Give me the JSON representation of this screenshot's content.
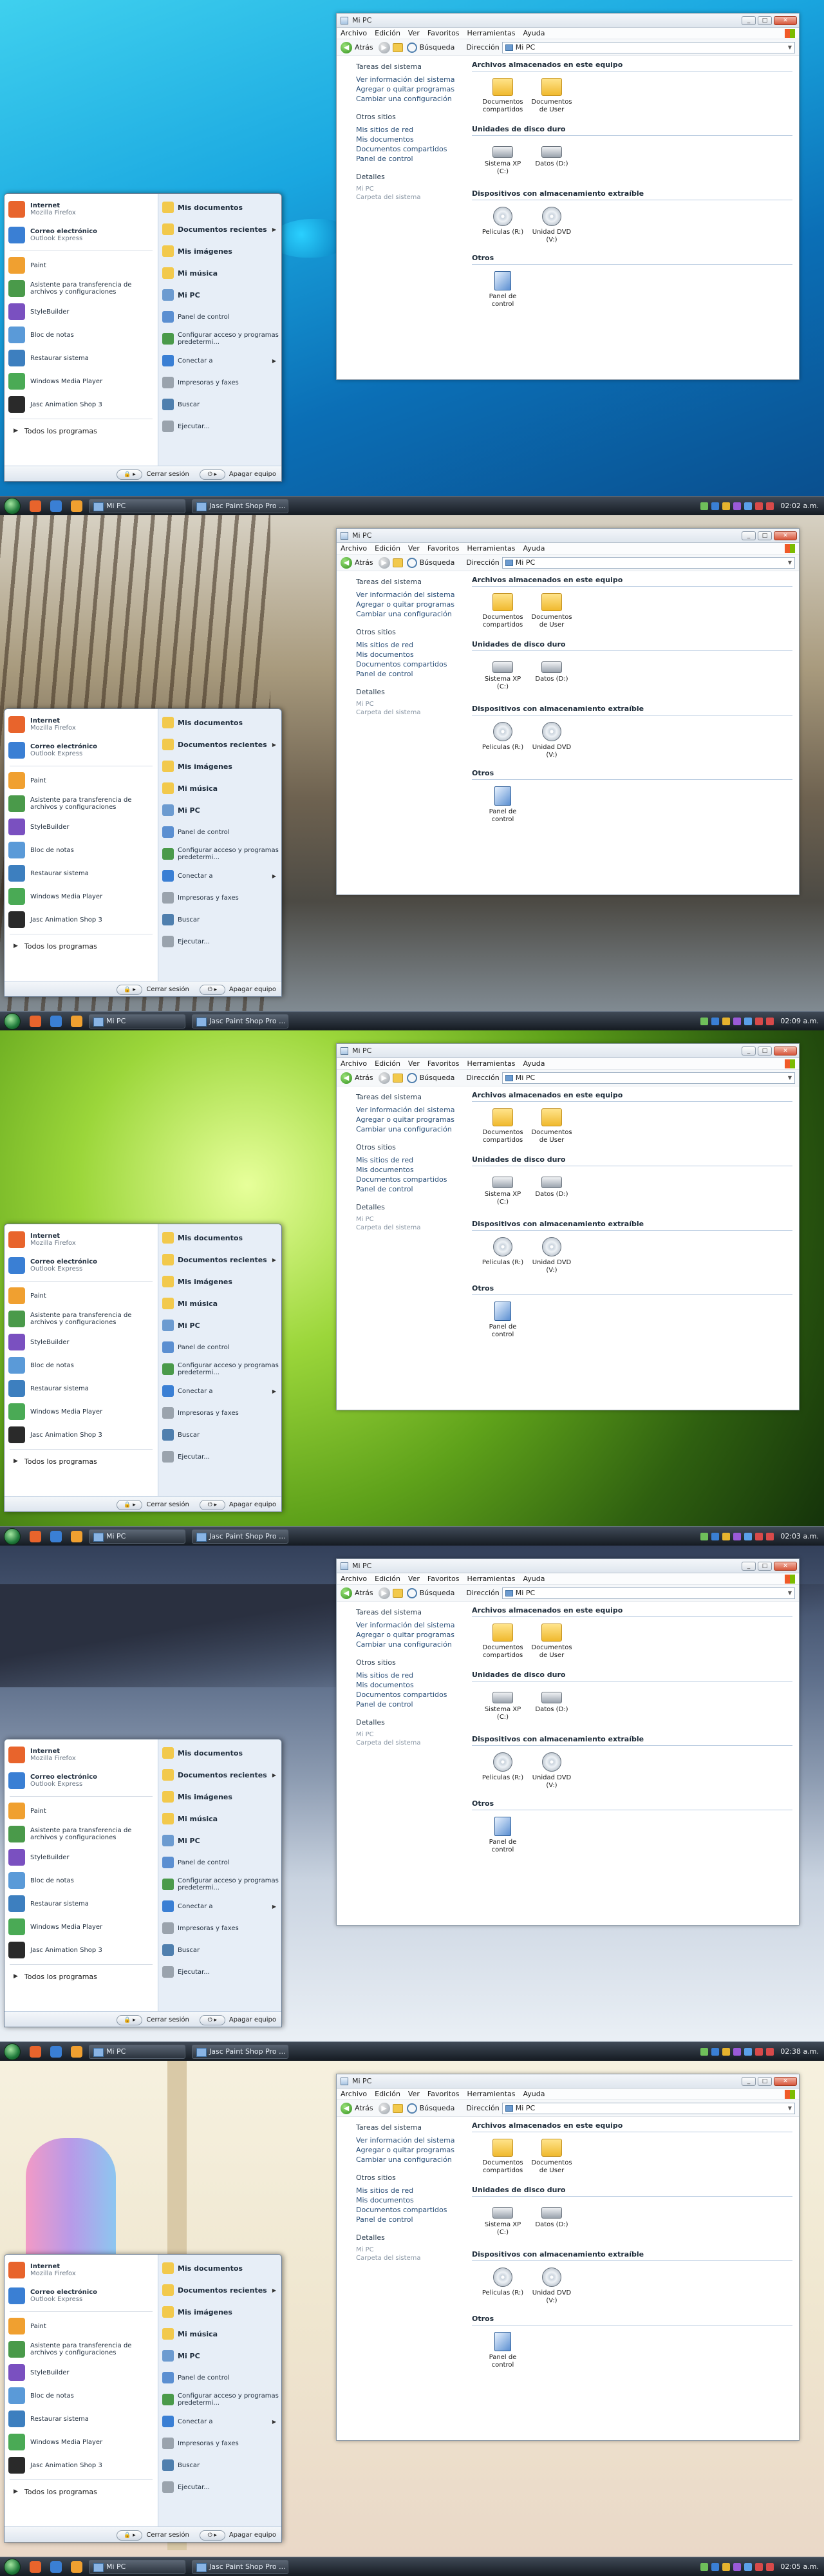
{
  "explorer": {
    "title": "Mi PC",
    "menu": [
      "Archivo",
      "Edición",
      "Ver",
      "Favoritos",
      "Herramientas",
      "Ayuda"
    ],
    "back_label": "Atrás",
    "search_label": "Búsqueda",
    "address_label": "Dirección",
    "address_value": "Mi PC",
    "tasks": {
      "system_head": "Tareas del sistema",
      "system_links": [
        "Ver información del sistema",
        "Agregar o quitar programas",
        "Cambiar una configuración"
      ],
      "other_head": "Otros sitios",
      "other_links": [
        "Mis sitios de red",
        "Mis documentos",
        "Documentos compartidos",
        "Panel de control"
      ],
      "details_head": "Detalles",
      "details_title": "Mi PC",
      "details_sub": "Carpeta del sistema"
    },
    "sections": {
      "stored": "Archivos almacenados en este equipo",
      "hdd": "Unidades de disco duro",
      "removable": "Dispositivos con almacenamiento extraíble",
      "others": "Otros"
    },
    "stored_items": [
      "Documentos compartidos",
      "Documentos de User"
    ],
    "hdd_items": [
      "Sistema XP (C:)",
      "Datos (D:)"
    ],
    "removable_items": [
      "Peliculas (R:)",
      "Unidad DVD (V:)"
    ],
    "other_items": [
      "Panel de control"
    ]
  },
  "start_menu": {
    "pinned": [
      {
        "title": "Internet",
        "sub": "Mozilla Firefox",
        "color": "#e8642c"
      },
      {
        "title": "Correo electrónico",
        "sub": "Outlook Express",
        "color": "#3a7fd4"
      }
    ],
    "recent": [
      {
        "label": "Paint",
        "color": "#f0a030"
      },
      {
        "label": "Asistente para transferencia de archivos y configuraciones",
        "color": "#4a9a4a"
      },
      {
        "label": "StyleBuilder",
        "color": "#7a50c0"
      },
      {
        "label": "Bloc de notas",
        "color": "#5a9ad8"
      },
      {
        "label": "Restaurar sistema",
        "color": "#3d7fbf"
      },
      {
        "label": "Windows Media Player",
        "color": "#4aaa55"
      },
      {
        "label": "Jasc Animation Shop 3",
        "color": "#2a2a2a"
      }
    ],
    "all_programs": "Todos los programas",
    "right": [
      {
        "label": "Mis documentos",
        "bold": true,
        "arrow": false,
        "color": "#f2c94c"
      },
      {
        "label": "Documentos recientes",
        "bold": true,
        "arrow": true,
        "color": "#f2c94c"
      },
      {
        "label": "Mis imágenes",
        "bold": true,
        "arrow": false,
        "color": "#f2c94c"
      },
      {
        "label": "Mi música",
        "bold": true,
        "arrow": false,
        "color": "#f2c94c"
      },
      {
        "label": "Mi PC",
        "bold": true,
        "arrow": false,
        "color": "#6c9bd0"
      },
      {
        "label": "Panel de control",
        "bold": false,
        "arrow": false,
        "color": "#5b8fd1"
      },
      {
        "label": "Configurar acceso y programas predetermi...",
        "bold": false,
        "arrow": false,
        "color": "#4a9a4a"
      },
      {
        "label": "Conectar a",
        "bold": false,
        "arrow": true,
        "color": "#3a7fd4"
      },
      {
        "label": "Impresoras y faxes",
        "bold": false,
        "arrow": false,
        "color": "#9aa3ad"
      },
      {
        "label": "Buscar",
        "bold": false,
        "arrow": false,
        "color": "#4f7fae"
      },
      {
        "label": "Ejecutar...",
        "bold": false,
        "arrow": false,
        "color": "#9aa3ad"
      }
    ],
    "logoff": "Cerrar sesión",
    "shutdown": "Apagar equipo"
  },
  "taskbar": {
    "buttons": [
      "Mi PC",
      "Jasc Paint Shop Pro ..."
    ],
    "clocks": [
      "02:02 a.m.",
      "02:09 a.m.",
      "02:03 a.m.",
      "02:38 a.m.",
      "02:05 a.m."
    ]
  }
}
